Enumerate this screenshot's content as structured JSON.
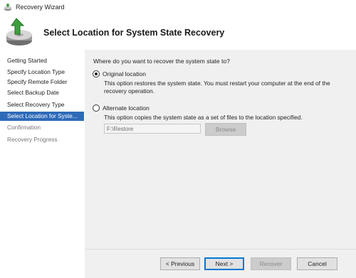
{
  "window": {
    "title": "Recovery Wizard"
  },
  "header": {
    "title": "Select Location for System State Recovery"
  },
  "nav": {
    "items": [
      {
        "label": "Getting Started",
        "state": "normal"
      },
      {
        "label": "Specify Location Type",
        "state": "normal"
      },
      {
        "label": "Specify Remote Folder",
        "state": "normal"
      },
      {
        "label": "Select Backup Date",
        "state": "normal"
      },
      {
        "label": "Select Recovery Type",
        "state": "normal"
      },
      {
        "label": "Select Location for Syste...",
        "state": "selected"
      },
      {
        "label": "Confirmation",
        "state": "disabled"
      },
      {
        "label": "Recovery Progress",
        "state": "disabled"
      }
    ]
  },
  "main": {
    "question": "Where do you want to recover the system state to?",
    "option_original": {
      "label": "Original location",
      "selected": true,
      "description_line1": "This option restores the system state. You must restart your computer at the end of the",
      "description_line2": "recovery operation."
    },
    "option_alternate": {
      "label": "Alternate location",
      "selected": false,
      "description": "This option copies the system state as a set of files to the location specified.",
      "path_value": "F:\\Restore",
      "browse_label": "Browse"
    }
  },
  "footer": {
    "previous_label": "< Previous",
    "next_label": "Next >",
    "recover_label": "Recover",
    "cancel_label": "Cancel"
  },
  "colors": {
    "selection": "#2f6ab8",
    "panel_bg": "#f0f0f0",
    "primary_border": "#0078d7"
  },
  "icons": {
    "app": "recovery-app-icon",
    "header": "backup-disk-arrow-icon"
  }
}
